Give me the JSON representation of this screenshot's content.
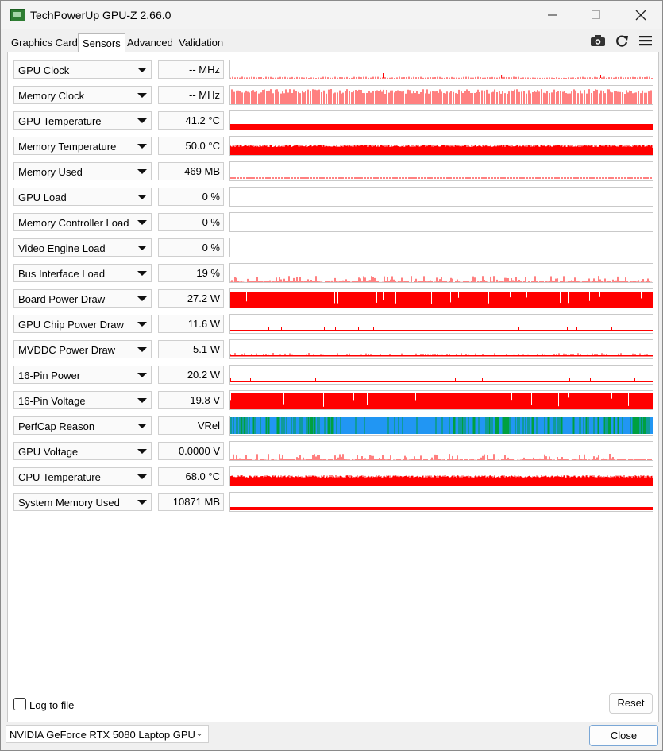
{
  "window": {
    "title": "TechPowerUp GPU-Z 2.66.0"
  },
  "tabs": [
    {
      "label": "Graphics Card",
      "active": false
    },
    {
      "label": "Sensors",
      "active": true
    },
    {
      "label": "Advanced",
      "active": false
    },
    {
      "label": "Validation",
      "active": false
    }
  ],
  "toolbar_icons": [
    "camera-icon",
    "refresh-icon",
    "hamburger-menu-icon"
  ],
  "colors": {
    "graph_red": "#ff0000",
    "perfcap_blue": "#2196f3",
    "perfcap_green": "#00a040"
  },
  "sensors": [
    {
      "name": "GPU Clock",
      "value": "-- MHz",
      "graph": "spikes_sparse"
    },
    {
      "name": "Memory Clock",
      "value": "-- MHz",
      "graph": "bars_dense"
    },
    {
      "name": "GPU Temperature",
      "value": "41.2 °C",
      "graph": "band_thick"
    },
    {
      "name": "Memory Temperature",
      "value": "50.0 °C",
      "graph": "band_noisy"
    },
    {
      "name": "Memory Used",
      "value": "469 MB",
      "graph": "line_dotted"
    },
    {
      "name": "GPU Load",
      "value": "0 %",
      "graph": "empty"
    },
    {
      "name": "Memory Controller Load",
      "value": "0 %",
      "graph": "empty"
    },
    {
      "name": "Video Engine Load",
      "value": "0 %",
      "graph": "empty"
    },
    {
      "name": "Bus Interface Load",
      "value": "19 %",
      "graph": "noise_low"
    },
    {
      "name": "Board Power Draw",
      "value": "27.2 W",
      "graph": "band_full"
    },
    {
      "name": "GPU Chip Power Draw",
      "value": "11.6 W",
      "graph": "line_thin"
    },
    {
      "name": "MVDDC Power Draw",
      "value": "5.1 W",
      "graph": "line_thin_noisy"
    },
    {
      "name": "16-Pin Power",
      "value": "20.2 W",
      "graph": "line_thin"
    },
    {
      "name": "16-Pin Voltage",
      "value": "19.8 V",
      "graph": "band_full"
    },
    {
      "name": "PerfCap Reason",
      "value": "VRel",
      "graph": "perfcap"
    },
    {
      "name": "GPU Voltage",
      "value": "0.0000 V",
      "graph": "noise_low"
    },
    {
      "name": "CPU Temperature",
      "value": "68.0 °C",
      "graph": "band_noisy"
    },
    {
      "name": "System Memory Used",
      "value": "10871 MB",
      "graph": "line_thick"
    }
  ],
  "footer": {
    "log_label": "Log to file",
    "log_checked": false,
    "reset_label": "Reset",
    "gpu_select": "NVIDIA GeForce RTX 5080 Laptop GPU",
    "close_label": "Close"
  }
}
